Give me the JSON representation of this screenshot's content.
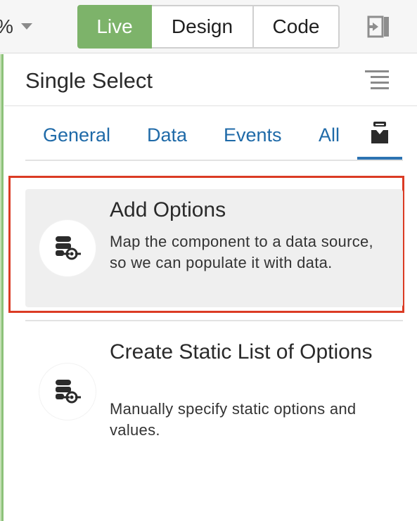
{
  "toolbar": {
    "zoom_text": "%",
    "modes": [
      {
        "label": "Live",
        "active": true
      },
      {
        "label": "Design",
        "active": false
      },
      {
        "label": "Code",
        "active": false
      }
    ],
    "collapse_icon": "panel-collapse-icon"
  },
  "panel": {
    "title": "Single Select",
    "menu_icon": "hamburger-menu-icon",
    "tabs": [
      "General",
      "Data",
      "Events",
      "All"
    ],
    "active_tab_icon": "data-binding-icon"
  },
  "cards": [
    {
      "title": "Add Options",
      "description": "Map the component to a data source, so we can populate it with data.",
      "icon": "database-link-icon",
      "highlighted": true
    },
    {
      "title": "Create Static List of Options",
      "description": "Manually specify static options and values.",
      "icon": "database-link-icon",
      "highlighted": false
    }
  ],
  "colors": {
    "live_green": "#7db36a",
    "link_blue": "#1f6aa8",
    "highlight_red": "#db3b24",
    "card_bg": "#efefef"
  }
}
